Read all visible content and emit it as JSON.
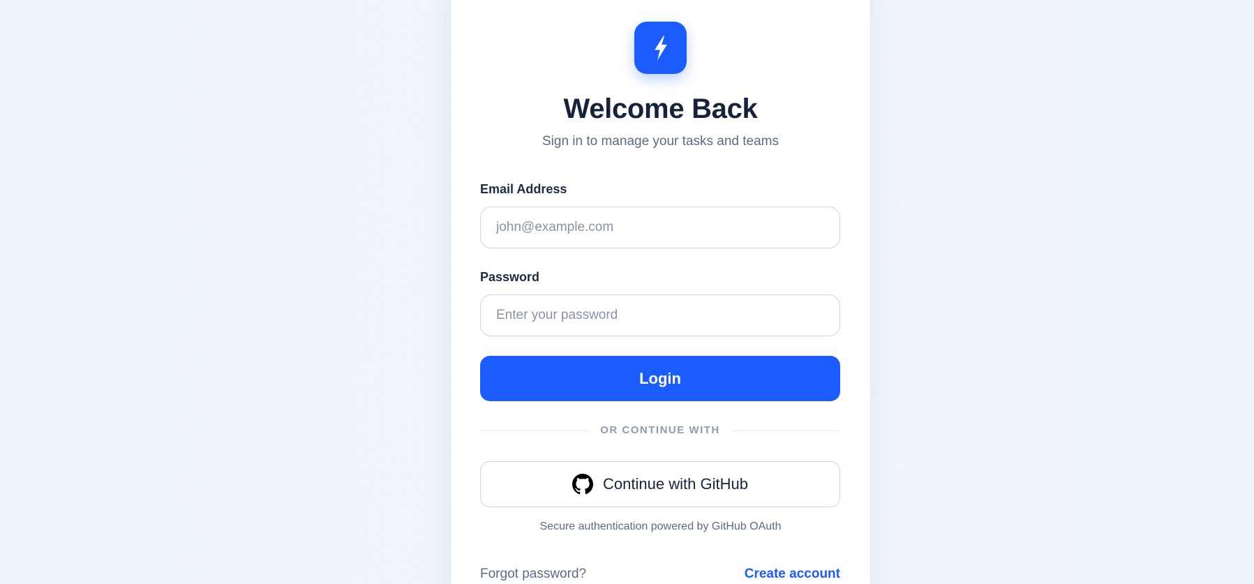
{
  "brand": {
    "logo_icon": "lightning-bolt-icon",
    "accent_color": "#1a5cff"
  },
  "header": {
    "title": "Welcome Back",
    "subtitle": "Sign in to manage your tasks and teams"
  },
  "form": {
    "email": {
      "label": "Email Address",
      "value": "",
      "placeholder": "john@example.com"
    },
    "password": {
      "label": "Password",
      "value": "",
      "placeholder": "Enter your password"
    },
    "login_label": "Login"
  },
  "divider": {
    "text": "OR CONTINUE WITH"
  },
  "oauth": {
    "github_icon": "github-icon",
    "github_label": "Continue with GitHub",
    "note": "Secure authentication powered by GitHub OAuth"
  },
  "footer": {
    "forgot_label": "Forgot password?",
    "create_label": "Create account"
  }
}
